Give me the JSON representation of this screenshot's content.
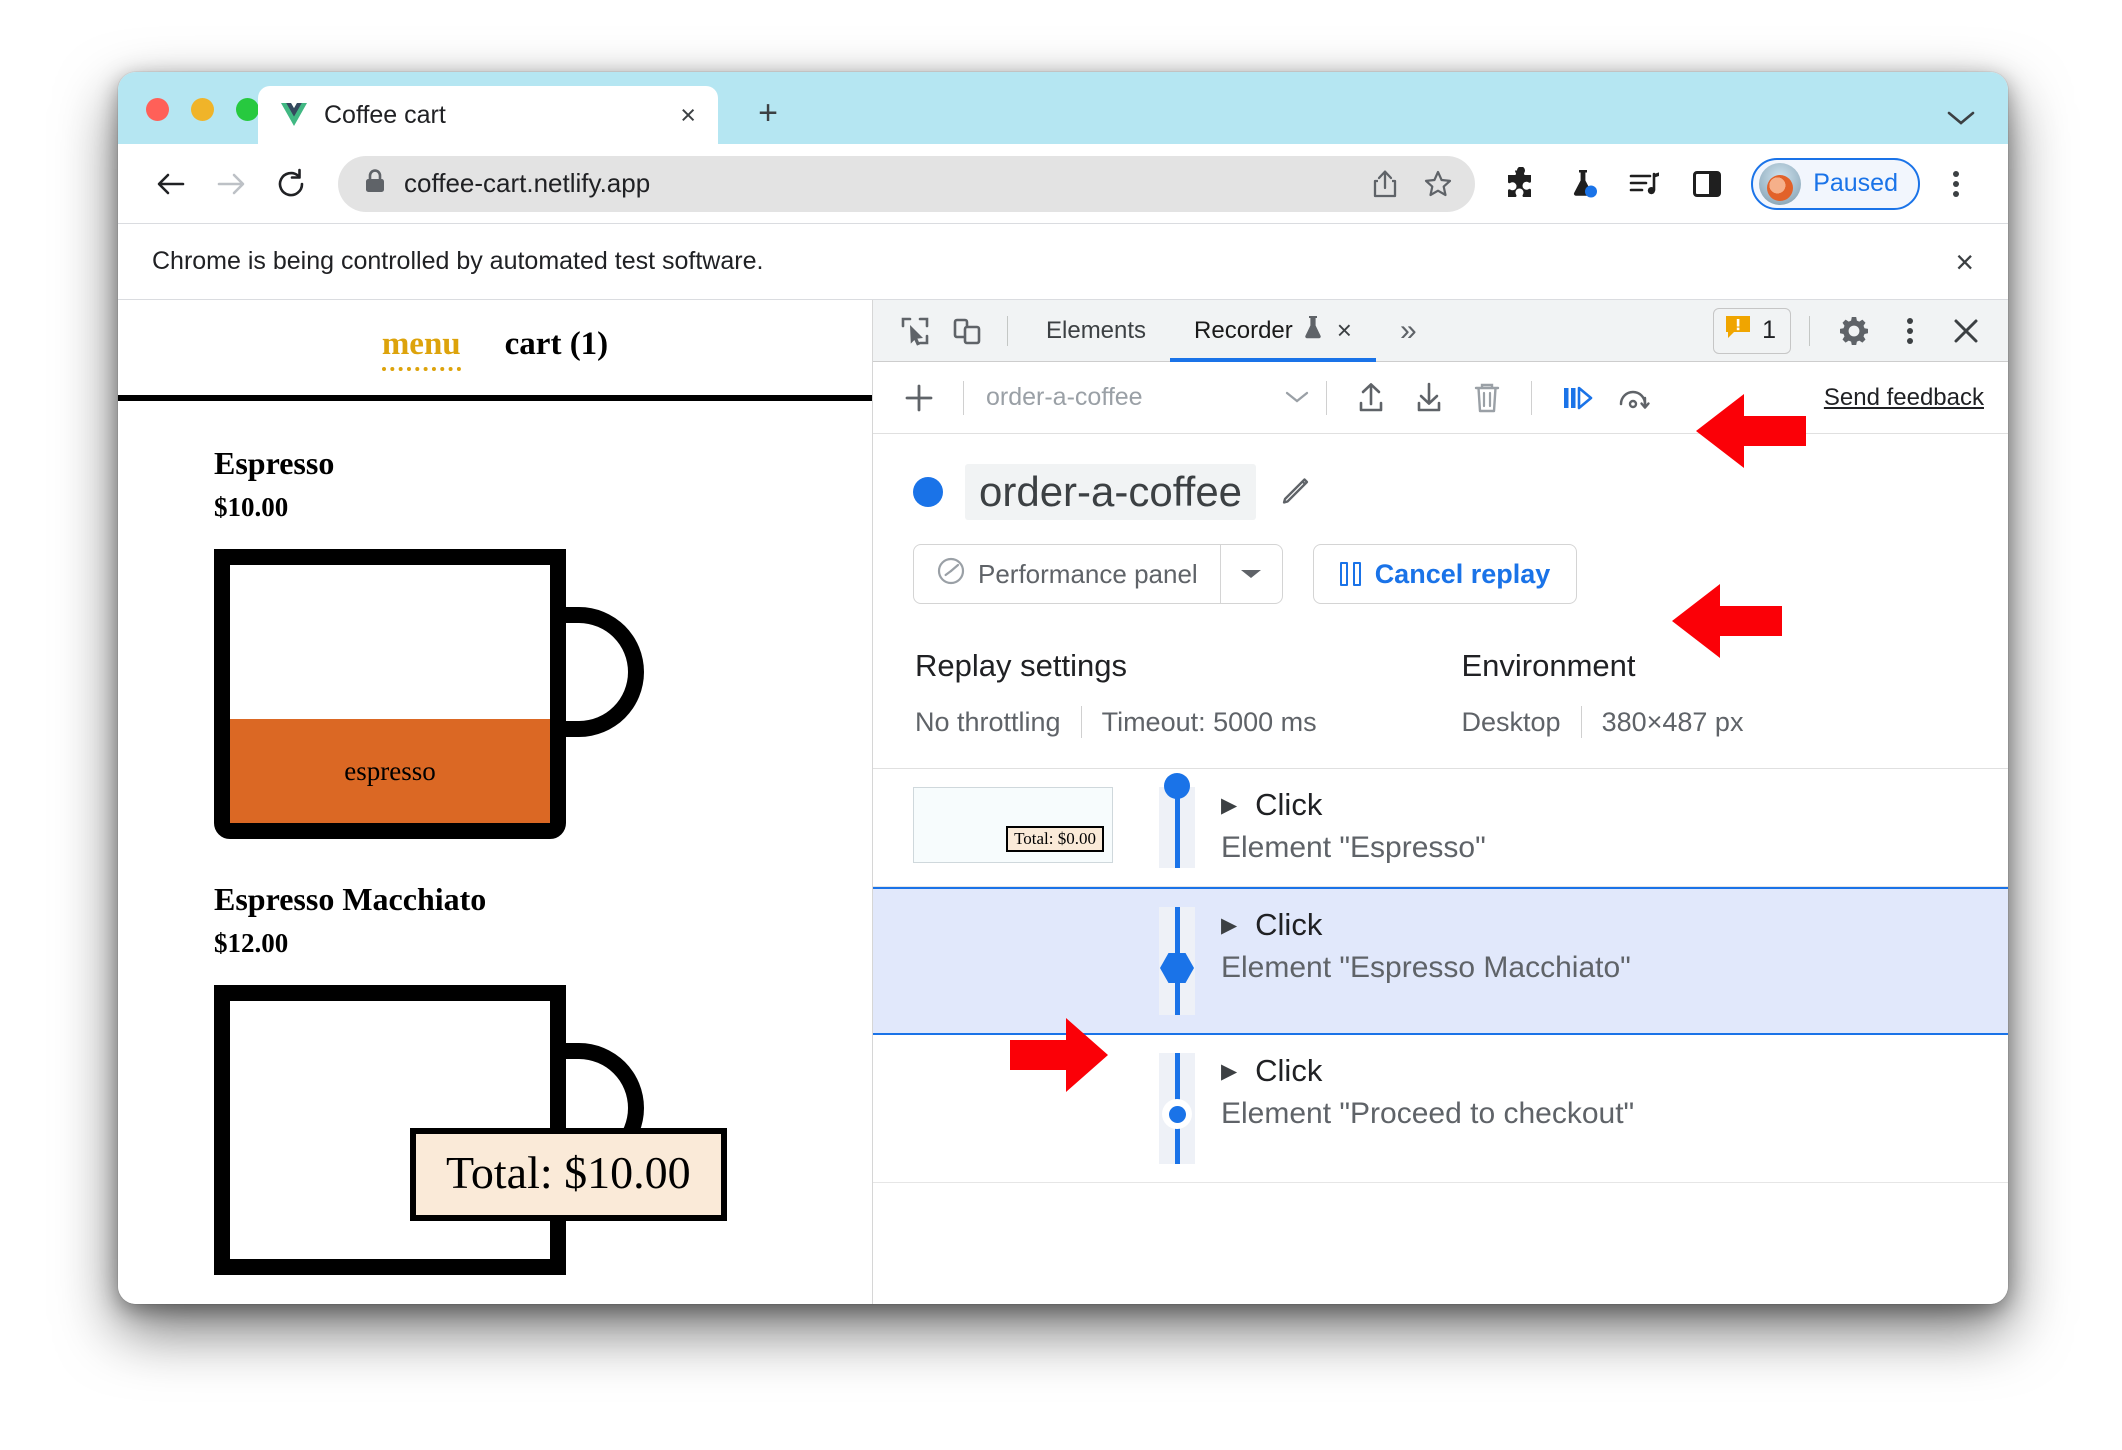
{
  "browser": {
    "tab": {
      "title": "Coffee cart",
      "favicon": "vue-logo-icon",
      "close": "×"
    },
    "new_tab_label": "+",
    "url": "coffee-cart.netlify.app",
    "lock_icon": "lock-icon",
    "share_icon": "share-icon",
    "bookmark_icon": "star-icon",
    "extensions_icon": "puzzle-piece-icon",
    "labs_icon": "flask-icon",
    "media_icon": "media-list-icon",
    "sidepanel_icon": "side-panel-icon",
    "profile_label": "Paused",
    "menu_icon": "kebab-menu-icon",
    "infobar_text": "Chrome is being controlled by automated test software.",
    "infobar_close": "×"
  },
  "page": {
    "nav": {
      "menu": "menu",
      "cart": "cart (1)"
    },
    "items": [
      {
        "name": "Espresso",
        "price": "$10.00",
        "cup_label": "espresso"
      },
      {
        "name": "Espresso Macchiato",
        "price": "$12.00",
        "cup_label": ""
      }
    ],
    "total_badge": "Total: $10.00"
  },
  "devtools": {
    "inspect_icon": "inspect-element-icon",
    "device_icon": "device-toolbar-icon",
    "tabs": [
      {
        "label": "Elements",
        "active": false
      },
      {
        "label": "Recorder",
        "active": true,
        "experimental_icon": "flask-icon",
        "close": "×"
      }
    ],
    "more_tabs": "»",
    "warning_icon": "warning-icon",
    "warning_count": "1",
    "settings_icon": "gear-icon",
    "more_icon": "kebab-menu-icon",
    "close_icon": "close-icon",
    "toolbar": {
      "add_icon": "plus-icon",
      "recording_select": "order-a-coffee",
      "select_chevron": "chevron-down-icon",
      "import_icon": "upload-icon",
      "export_icon": "download-icon",
      "delete_icon": "trash-icon",
      "step_by_step_icon": "replay-step-by-step-icon",
      "speed_icon": "replay-speed-icon",
      "send_feedback": "Send feedback"
    },
    "recording": {
      "status_dot": "recording-status-dot",
      "name": "order-a-coffee",
      "edit_icon": "pencil-icon",
      "perf_panel_label": "Performance panel",
      "perf_panel_icon": "performance-gauge-icon",
      "perf_chevron": "chevron-down-icon",
      "cancel_label": "Cancel replay",
      "cancel_icon": "pause-icon"
    },
    "settings": {
      "replay_heading": "Replay settings",
      "throttling": "No throttling",
      "timeout": "Timeout: 5000 ms",
      "environment_heading": "Environment",
      "device": "Desktop",
      "viewport": "380×487 px"
    },
    "steps": [
      {
        "type": "Click",
        "target": "Element \"Espresso\"",
        "caret": "▶",
        "state": "done",
        "thumb_total": "Total: $0.00",
        "has_thumb": true,
        "selected": false
      },
      {
        "type": "Click",
        "target": "Element \"Espresso Macchiato\"",
        "caret": "▶",
        "state": "current",
        "has_thumb": false,
        "selected": true
      },
      {
        "type": "Click",
        "target": "Element \"Proceed to checkout\"",
        "caret": "▶",
        "state": "pending",
        "has_thumb": false,
        "selected": false
      }
    ]
  },
  "annotations": {
    "arrow_color": "#fb0007",
    "arrows": [
      {
        "name": "arrow-pointing-replay-speed",
        "direction": "left"
      },
      {
        "name": "arrow-pointing-cancel-replay",
        "direction": "left"
      },
      {
        "name": "arrow-pointing-current-step",
        "direction": "right"
      }
    ]
  },
  "colors": {
    "accent_blue": "#1a73e8",
    "tab_strip": "#b5e6f2",
    "coffee_orange": "#db6824",
    "menu_gold": "#dda30b",
    "badge_bg": "#faead8",
    "selected_step_bg": "#e1e8fb"
  }
}
